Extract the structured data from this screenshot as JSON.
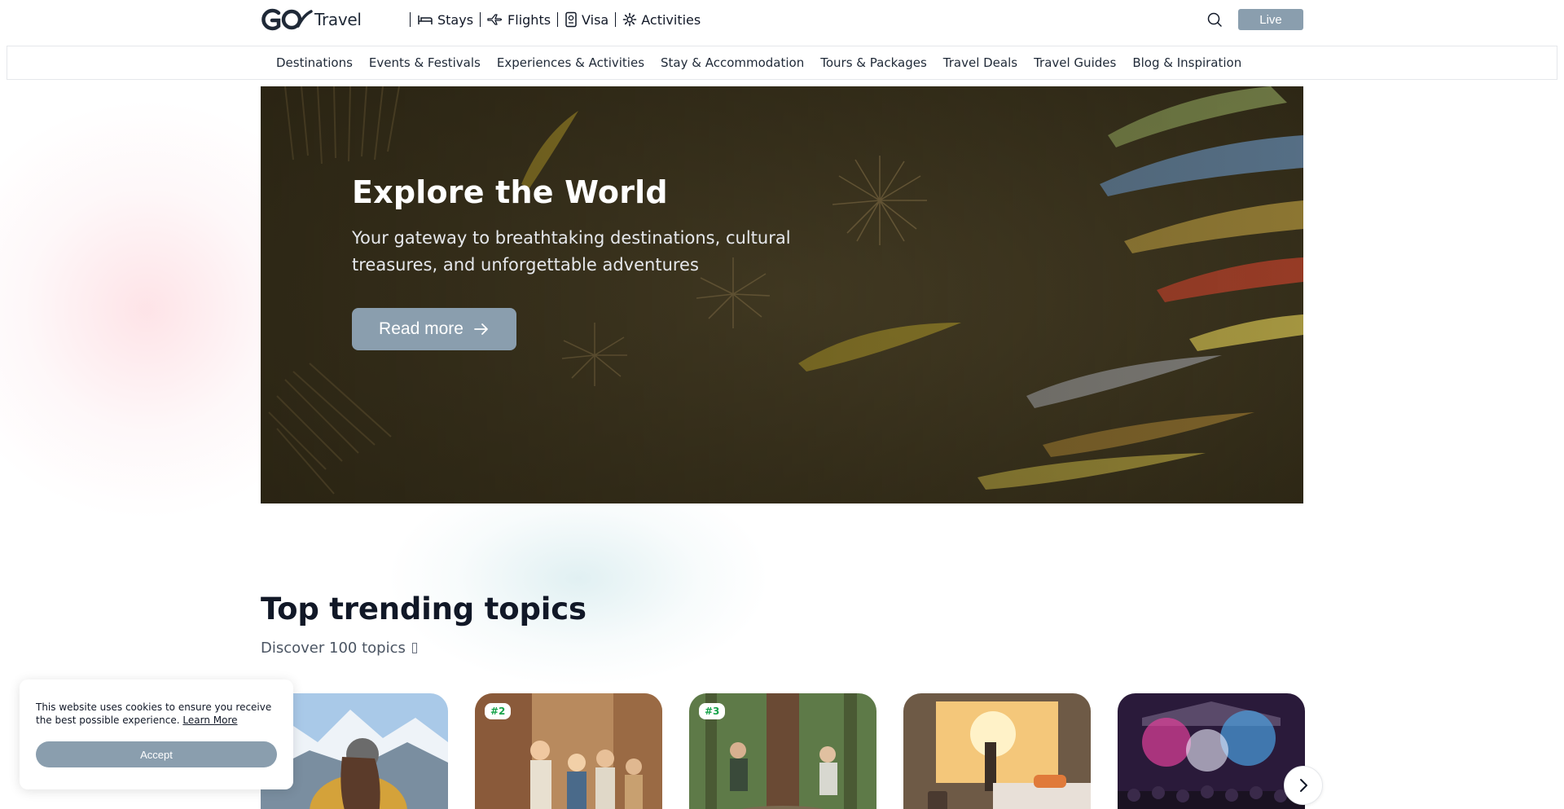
{
  "header": {
    "logo_text": "Travel",
    "services": [
      {
        "label": "Stays",
        "icon": "bed-icon"
      },
      {
        "label": "Flights",
        "icon": "plane-icon"
      },
      {
        "label": "Visa",
        "icon": "passport-icon"
      },
      {
        "label": "Activities",
        "icon": "gear-icon"
      }
    ],
    "live_label": "Live"
  },
  "categories": [
    "Destinations",
    "Events & Festivals",
    "Experiences & Activities",
    "Stay & Accommodation",
    "Tours & Packages",
    "Travel Deals",
    "Travel Guides",
    "Blog & Inspiration"
  ],
  "hero": {
    "title": "Explore the World",
    "subtitle": "Your gateway to breathtaking destinations, cultural treasures, and unforgettable adventures",
    "cta": "Read more"
  },
  "trending": {
    "title": "Top trending topics",
    "subtitle": "Discover 100 topics ",
    "cards": [
      {
        "rank": ""
      },
      {
        "rank": "#2"
      },
      {
        "rank": "#3"
      },
      {
        "rank": ""
      },
      {
        "rank": ""
      }
    ]
  },
  "cookie": {
    "text": "This website uses cookies to ensure you receive the best possible experience.",
    "link": "Learn More",
    "accept": "Accept"
  },
  "colors": {
    "accent": "#8a9eae",
    "rank_text": "#16a34a"
  }
}
